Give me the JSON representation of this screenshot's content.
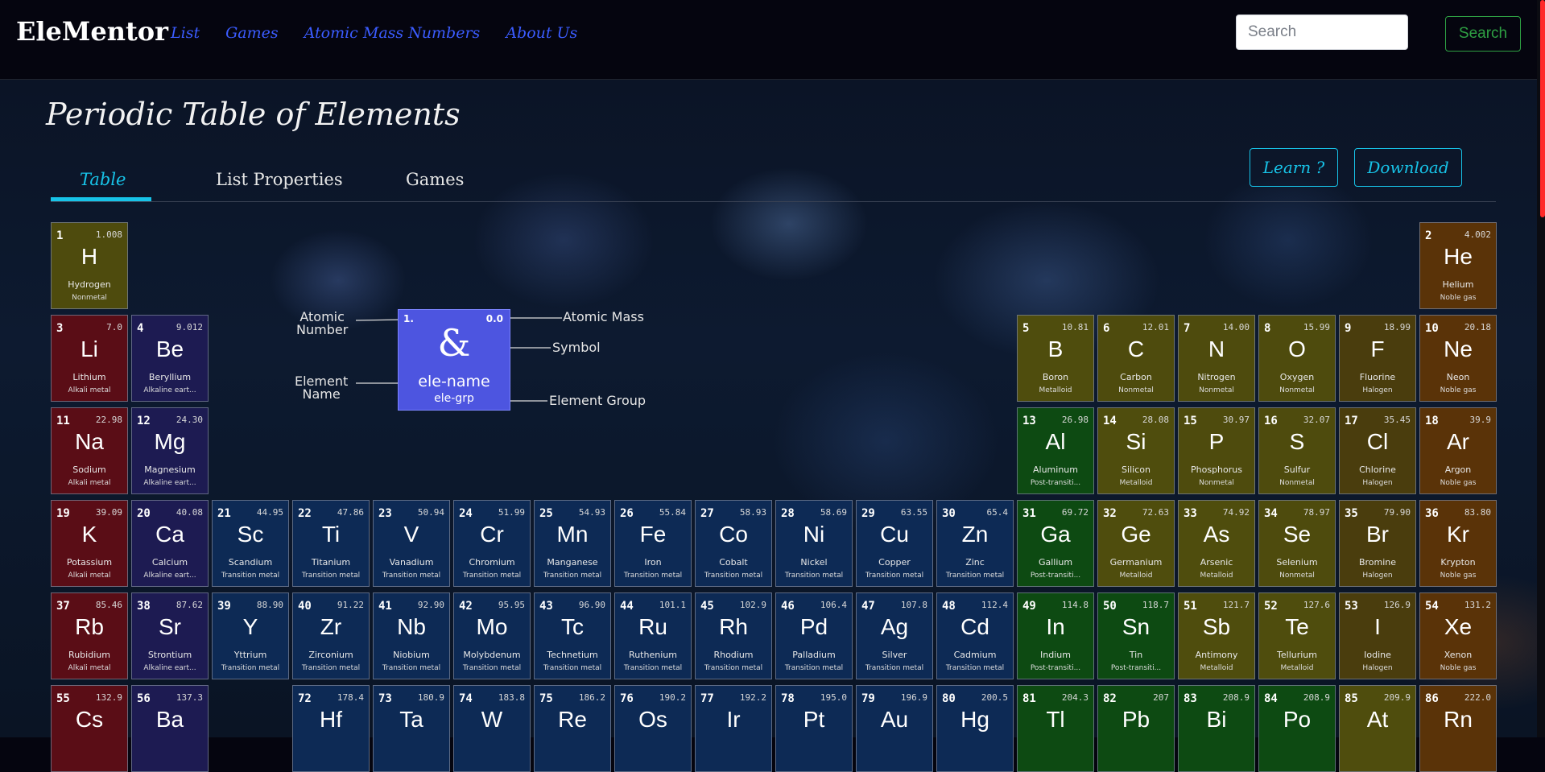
{
  "navbar": {
    "brand": "EleMentor",
    "links": [
      "List",
      "Games",
      "Atomic Mass Numbers",
      "About Us"
    ],
    "search_placeholder": "Search",
    "search_button": "Search"
  },
  "page": {
    "title": "Periodic Table of Elements",
    "tabs": [
      "Table",
      "List Properties",
      "Games"
    ],
    "active_tab": "Table",
    "learn_button": "Learn ?",
    "download_button": "Download"
  },
  "legend": {
    "number": "1.",
    "mass": "0.0",
    "symbol": "&",
    "name": "ele-name",
    "group": "ele-grp",
    "label_atomic_number": "Atomic\nNumber",
    "label_atomic_mass": "Atomic Mass",
    "label_symbol": "Symbol",
    "label_element_name": "Element\nName",
    "label_element_group": "Element Group"
  },
  "colors": {
    "alkali": "#5a0d16",
    "alkaline": "#1d1b52",
    "transition": "#0d2a55",
    "post_transition": "#0d4a12",
    "metalloid": "#4f4d0d",
    "nonmetal": "#4e4b0d",
    "halogen": "#4a3d0d",
    "noble": "#5a3308",
    "accent": "#17c3e8",
    "link": "#3b5cff",
    "search_green": "#2ea043"
  },
  "elements": [
    {
      "n": "1",
      "s": "H",
      "name": "Hydrogen",
      "m": "1.008",
      "g": "Nonmetal",
      "c": "nonmetal",
      "col": 1,
      "row": 1
    },
    {
      "n": "2",
      "s": "He",
      "name": "Helium",
      "m": "4.002",
      "g": "Noble gas",
      "c": "noble",
      "col": 18,
      "row": 1
    },
    {
      "n": "3",
      "s": "Li",
      "name": "Lithium",
      "m": "7.0",
      "g": "Alkali metal",
      "c": "alkali",
      "col": 1,
      "row": 2
    },
    {
      "n": "4",
      "s": "Be",
      "name": "Beryllium",
      "m": "9.012",
      "g": "Alkaline eart...",
      "c": "alkaline",
      "col": 2,
      "row": 2
    },
    {
      "n": "5",
      "s": "B",
      "name": "Boron",
      "m": "10.81",
      "g": "Metalloid",
      "c": "metalloid",
      "col": 13,
      "row": 2
    },
    {
      "n": "6",
      "s": "C",
      "name": "Carbon",
      "m": "12.01",
      "g": "Nonmetal",
      "c": "nonmetal",
      "col": 14,
      "row": 2
    },
    {
      "n": "7",
      "s": "N",
      "name": "Nitrogen",
      "m": "14.00",
      "g": "Nonmetal",
      "c": "nonmetal",
      "col": 15,
      "row": 2
    },
    {
      "n": "8",
      "s": "O",
      "name": "Oxygen",
      "m": "15.99",
      "g": "Nonmetal",
      "c": "nonmetal",
      "col": 16,
      "row": 2
    },
    {
      "n": "9",
      "s": "F",
      "name": "Fluorine",
      "m": "18.99",
      "g": "Halogen",
      "c": "halogen",
      "col": 17,
      "row": 2
    },
    {
      "n": "10",
      "s": "Ne",
      "name": "Neon",
      "m": "20.18",
      "g": "Noble gas",
      "c": "noble",
      "col": 18,
      "row": 2
    },
    {
      "n": "11",
      "s": "Na",
      "name": "Sodium",
      "m": "22.98",
      "g": "Alkali metal",
      "c": "alkali",
      "col": 1,
      "row": 3
    },
    {
      "n": "12",
      "s": "Mg",
      "name": "Magnesium",
      "m": "24.30",
      "g": "Alkaline eart...",
      "c": "alkaline",
      "col": 2,
      "row": 3
    },
    {
      "n": "13",
      "s": "Al",
      "name": "Aluminum",
      "m": "26.98",
      "g": "Post-transiti...",
      "c": "post_transition",
      "col": 13,
      "row": 3
    },
    {
      "n": "14",
      "s": "Si",
      "name": "Silicon",
      "m": "28.08",
      "g": "Metalloid",
      "c": "metalloid",
      "col": 14,
      "row": 3
    },
    {
      "n": "15",
      "s": "P",
      "name": "Phosphorus",
      "m": "30.97",
      "g": "Nonmetal",
      "c": "nonmetal",
      "col": 15,
      "row": 3
    },
    {
      "n": "16",
      "s": "S",
      "name": "Sulfur",
      "m": "32.07",
      "g": "Nonmetal",
      "c": "nonmetal",
      "col": 16,
      "row": 3
    },
    {
      "n": "17",
      "s": "Cl",
      "name": "Chlorine",
      "m": "35.45",
      "g": "Halogen",
      "c": "halogen",
      "col": 17,
      "row": 3
    },
    {
      "n": "18",
      "s": "Ar",
      "name": "Argon",
      "m": "39.9",
      "g": "Noble gas",
      "c": "noble",
      "col": 18,
      "row": 3
    },
    {
      "n": "19",
      "s": "K",
      "name": "Potassium",
      "m": "39.09",
      "g": "Alkali metal",
      "c": "alkali",
      "col": 1,
      "row": 4
    },
    {
      "n": "20",
      "s": "Ca",
      "name": "Calcium",
      "m": "40.08",
      "g": "Alkaline eart...",
      "c": "alkaline",
      "col": 2,
      "row": 4
    },
    {
      "n": "21",
      "s": "Sc",
      "name": "Scandium",
      "m": "44.95",
      "g": "Transition metal",
      "c": "transition",
      "col": 3,
      "row": 4
    },
    {
      "n": "22",
      "s": "Ti",
      "name": "Titanium",
      "m": "47.86",
      "g": "Transition metal",
      "c": "transition",
      "col": 4,
      "row": 4
    },
    {
      "n": "23",
      "s": "V",
      "name": "Vanadium",
      "m": "50.94",
      "g": "Transition metal",
      "c": "transition",
      "col": 5,
      "row": 4
    },
    {
      "n": "24",
      "s": "Cr",
      "name": "Chromium",
      "m": "51.99",
      "g": "Transition metal",
      "c": "transition",
      "col": 6,
      "row": 4
    },
    {
      "n": "25",
      "s": "Mn",
      "name": "Manganese",
      "m": "54.93",
      "g": "Transition metal",
      "c": "transition",
      "col": 7,
      "row": 4
    },
    {
      "n": "26",
      "s": "Fe",
      "name": "Iron",
      "m": "55.84",
      "g": "Transition metal",
      "c": "transition",
      "col": 8,
      "row": 4
    },
    {
      "n": "27",
      "s": "Co",
      "name": "Cobalt",
      "m": "58.93",
      "g": "Transition metal",
      "c": "transition",
      "col": 9,
      "row": 4
    },
    {
      "n": "28",
      "s": "Ni",
      "name": "Nickel",
      "m": "58.69",
      "g": "Transition metal",
      "c": "transition",
      "col": 10,
      "row": 4
    },
    {
      "n": "29",
      "s": "Cu",
      "name": "Copper",
      "m": "63.55",
      "g": "Transition metal",
      "c": "transition",
      "col": 11,
      "row": 4
    },
    {
      "n": "30",
      "s": "Zn",
      "name": "Zinc",
      "m": "65.4",
      "g": "Transition metal",
      "c": "transition",
      "col": 12,
      "row": 4
    },
    {
      "n": "31",
      "s": "Ga",
      "name": "Gallium",
      "m": "69.72",
      "g": "Post-transiti...",
      "c": "post_transition",
      "col": 13,
      "row": 4
    },
    {
      "n": "32",
      "s": "Ge",
      "name": "Germanium",
      "m": "72.63",
      "g": "Metalloid",
      "c": "metalloid",
      "col": 14,
      "row": 4
    },
    {
      "n": "33",
      "s": "As",
      "name": "Arsenic",
      "m": "74.92",
      "g": "Metalloid",
      "c": "metalloid",
      "col": 15,
      "row": 4
    },
    {
      "n": "34",
      "s": "Se",
      "name": "Selenium",
      "m": "78.97",
      "g": "Nonmetal",
      "c": "nonmetal",
      "col": 16,
      "row": 4
    },
    {
      "n": "35",
      "s": "Br",
      "name": "Bromine",
      "m": "79.90",
      "g": "Halogen",
      "c": "halogen",
      "col": 17,
      "row": 4
    },
    {
      "n": "36",
      "s": "Kr",
      "name": "Krypton",
      "m": "83.80",
      "g": "Noble gas",
      "c": "noble",
      "col": 18,
      "row": 4
    },
    {
      "n": "37",
      "s": "Rb",
      "name": "Rubidium",
      "m": "85.46",
      "g": "Alkali metal",
      "c": "alkali",
      "col": 1,
      "row": 5
    },
    {
      "n": "38",
      "s": "Sr",
      "name": "Strontium",
      "m": "87.62",
      "g": "Alkaline eart...",
      "c": "alkaline",
      "col": 2,
      "row": 5
    },
    {
      "n": "39",
      "s": "Y",
      "name": "Yttrium",
      "m": "88.90",
      "g": "Transition metal",
      "c": "transition",
      "col": 3,
      "row": 5
    },
    {
      "n": "40",
      "s": "Zr",
      "name": "Zirconium",
      "m": "91.22",
      "g": "Transition metal",
      "c": "transition",
      "col": 4,
      "row": 5
    },
    {
      "n": "41",
      "s": "Nb",
      "name": "Niobium",
      "m": "92.90",
      "g": "Transition metal",
      "c": "transition",
      "col": 5,
      "row": 5
    },
    {
      "n": "42",
      "s": "Mo",
      "name": "Molybdenum",
      "m": "95.95",
      "g": "Transition metal",
      "c": "transition",
      "col": 6,
      "row": 5
    },
    {
      "n": "43",
      "s": "Tc",
      "name": "Technetium",
      "m": "96.90",
      "g": "Transition metal",
      "c": "transition",
      "col": 7,
      "row": 5
    },
    {
      "n": "44",
      "s": "Ru",
      "name": "Ruthenium",
      "m": "101.1",
      "g": "Transition metal",
      "c": "transition",
      "col": 8,
      "row": 5
    },
    {
      "n": "45",
      "s": "Rh",
      "name": "Rhodium",
      "m": "102.9",
      "g": "Transition metal",
      "c": "transition",
      "col": 9,
      "row": 5
    },
    {
      "n": "46",
      "s": "Pd",
      "name": "Palladium",
      "m": "106.4",
      "g": "Transition metal",
      "c": "transition",
      "col": 10,
      "row": 5
    },
    {
      "n": "47",
      "s": "Ag",
      "name": "Silver",
      "m": "107.8",
      "g": "Transition metal",
      "c": "transition",
      "col": 11,
      "row": 5
    },
    {
      "n": "48",
      "s": "Cd",
      "name": "Cadmium",
      "m": "112.4",
      "g": "Transition metal",
      "c": "transition",
      "col": 12,
      "row": 5
    },
    {
      "n": "49",
      "s": "In",
      "name": "Indium",
      "m": "114.8",
      "g": "Post-transiti...",
      "c": "post_transition",
      "col": 13,
      "row": 5
    },
    {
      "n": "50",
      "s": "Sn",
      "name": "Tin",
      "m": "118.7",
      "g": "Post-transiti...",
      "c": "post_transition",
      "col": 14,
      "row": 5
    },
    {
      "n": "51",
      "s": "Sb",
      "name": "Antimony",
      "m": "121.7",
      "g": "Metalloid",
      "c": "metalloid",
      "col": 15,
      "row": 5
    },
    {
      "n": "52",
      "s": "Te",
      "name": "Tellurium",
      "m": "127.6",
      "g": "Metalloid",
      "c": "metalloid",
      "col": 16,
      "row": 5
    },
    {
      "n": "53",
      "s": "I",
      "name": "Iodine",
      "m": "126.9",
      "g": "Halogen",
      "c": "halogen",
      "col": 17,
      "row": 5
    },
    {
      "n": "54",
      "s": "Xe",
      "name": "Xenon",
      "m": "131.2",
      "g": "Noble gas",
      "c": "noble",
      "col": 18,
      "row": 5
    },
    {
      "n": "55",
      "s": "Cs",
      "name": "",
      "m": "132.9",
      "g": "",
      "c": "alkali",
      "col": 1,
      "row": 6
    },
    {
      "n": "56",
      "s": "Ba",
      "name": "",
      "m": "137.3",
      "g": "",
      "c": "alkaline",
      "col": 2,
      "row": 6
    },
    {
      "n": "72",
      "s": "Hf",
      "name": "",
      "m": "178.4",
      "g": "",
      "c": "transition",
      "col": 4,
      "row": 6
    },
    {
      "n": "73",
      "s": "Ta",
      "name": "",
      "m": "180.9",
      "g": "",
      "c": "transition",
      "col": 5,
      "row": 6
    },
    {
      "n": "74",
      "s": "W",
      "name": "",
      "m": "183.8",
      "g": "",
      "c": "transition",
      "col": 6,
      "row": 6
    },
    {
      "n": "75",
      "s": "Re",
      "name": "",
      "m": "186.2",
      "g": "",
      "c": "transition",
      "col": 7,
      "row": 6
    },
    {
      "n": "76",
      "s": "Os",
      "name": "",
      "m": "190.2",
      "g": "",
      "c": "transition",
      "col": 8,
      "row": 6
    },
    {
      "n": "77",
      "s": "Ir",
      "name": "",
      "m": "192.2",
      "g": "",
      "c": "transition",
      "col": 9,
      "row": 6
    },
    {
      "n": "78",
      "s": "Pt",
      "name": "",
      "m": "195.0",
      "g": "",
      "c": "transition",
      "col": 10,
      "row": 6
    },
    {
      "n": "79",
      "s": "Au",
      "name": "",
      "m": "196.9",
      "g": "",
      "c": "transition",
      "col": 11,
      "row": 6
    },
    {
      "n": "80",
      "s": "Hg",
      "name": "",
      "m": "200.5",
      "g": "",
      "c": "transition",
      "col": 12,
      "row": 6
    },
    {
      "n": "81",
      "s": "Tl",
      "name": "",
      "m": "204.3",
      "g": "",
      "c": "post_transition",
      "col": 13,
      "row": 6
    },
    {
      "n": "82",
      "s": "Pb",
      "name": "",
      "m": "207",
      "g": "",
      "c": "post_transition",
      "col": 14,
      "row": 6
    },
    {
      "n": "83",
      "s": "Bi",
      "name": "",
      "m": "208.9",
      "g": "",
      "c": "post_transition",
      "col": 15,
      "row": 6
    },
    {
      "n": "84",
      "s": "Po",
      "name": "",
      "m": "208.9",
      "g": "",
      "c": "post_transition",
      "col": 16,
      "row": 6
    },
    {
      "n": "85",
      "s": "At",
      "name": "",
      "m": "209.9",
      "g": "",
      "c": "metalloid",
      "col": 17,
      "row": 6
    },
    {
      "n": "86",
      "s": "Rn",
      "name": "",
      "m": "222.0",
      "g": "",
      "c": "noble",
      "col": 18,
      "row": 6
    }
  ]
}
